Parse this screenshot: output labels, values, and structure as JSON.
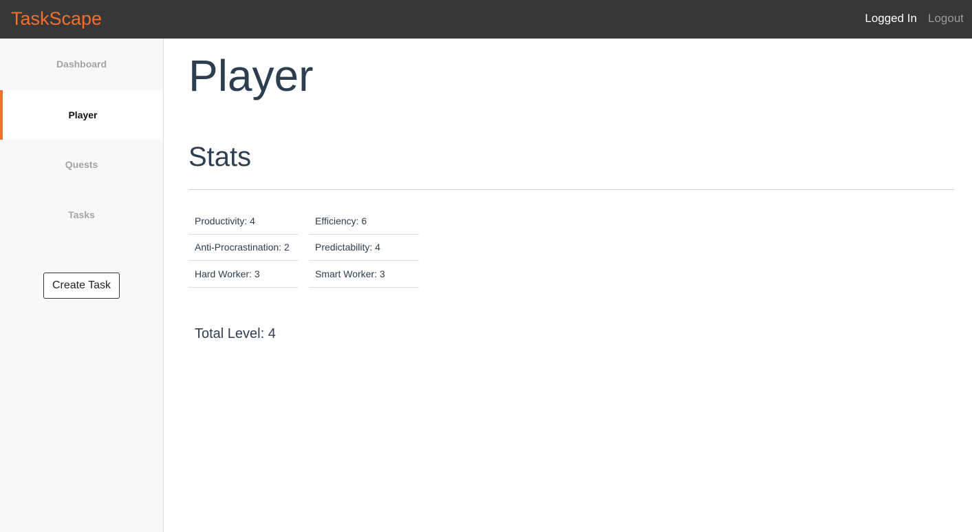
{
  "header": {
    "brand": "TaskScape",
    "status": "Logged In",
    "logout": "Logout",
    "accent_color": "#f36f2f"
  },
  "sidebar": {
    "items": [
      {
        "label": "Dashboard",
        "active": false
      },
      {
        "label": "Player",
        "active": true
      },
      {
        "label": "Quests",
        "active": false
      },
      {
        "label": "Tasks",
        "active": false
      }
    ],
    "create_button": "Create Task"
  },
  "main": {
    "title": "Player",
    "section": "Stats",
    "stats_left": [
      "Productivity: 4",
      "Anti-Procrastination: 2",
      "Hard Worker: 3"
    ],
    "stats_right": [
      "Efficiency: 6",
      "Predictability: 4",
      "Smart Worker: 3"
    ],
    "total_level": "Total Level: 4"
  }
}
